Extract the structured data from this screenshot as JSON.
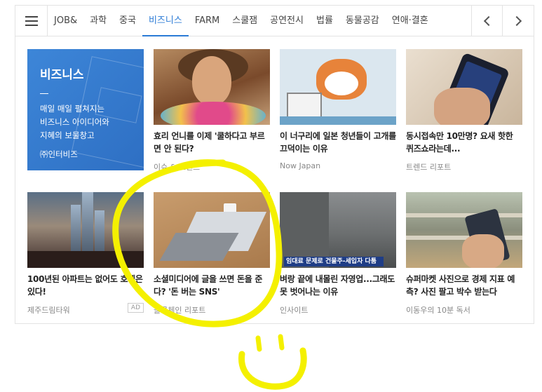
{
  "nav": {
    "menu_icon": "hamburger-icon",
    "tabs": [
      {
        "label": "JOB&",
        "active": false
      },
      {
        "label": "과학",
        "active": false
      },
      {
        "label": "중국",
        "active": false
      },
      {
        "label": "비즈니스",
        "active": true
      },
      {
        "label": "FARM",
        "active": false
      },
      {
        "label": "스쿨잼",
        "active": false
      },
      {
        "label": "공연전시",
        "active": false
      },
      {
        "label": "법률",
        "active": false
      },
      {
        "label": "동물공감",
        "active": false
      },
      {
        "label": "연애·결혼",
        "active": false
      }
    ],
    "prev_icon": "chevron-left-icon",
    "next_icon": "chevron-right-icon",
    "active_color": "#2b7bd6"
  },
  "promo": {
    "title": "비즈니스",
    "lines": [
      "매일 매일 펼쳐지는",
      "비즈니스 아이디어와",
      "지혜의 보물창고"
    ],
    "brand": "㈜인터비즈",
    "bg_color": "#3a80d2"
  },
  "cards": [
    {
      "title": "효리 언니를 이제 '쿨하다고 부르면 안 된다?",
      "source": "이슈 & 트렌드",
      "ad": ""
    },
    {
      "title": "이 너구리에 일본 청년들이 고개를 끄덕이는 이유",
      "source": "Now Japan",
      "ad": ""
    },
    {
      "title": "동시접속만 10만명? 요새 핫한 퀴즈쇼라는데...",
      "source": "트렌드 리포트",
      "ad": ""
    },
    {
      "title": "100년된 아파트는 없어도 호텔은 있다!",
      "source": "제주드림타워",
      "ad": "AD"
    },
    {
      "title": "소셜미디어에 글을 쓰면 돈을 준다? '돈 버는 SNS'",
      "source": "블록체인 리포트",
      "ad": ""
    },
    {
      "title": "벼랑 끝에 내몰린 자영업...그래도 못 벗어나는 이유",
      "source": "인사이트",
      "ad": "",
      "image_caption": "임대료 문제로 건물주-세입자 다툼"
    },
    {
      "title": "슈퍼마켓 사진으로 경제 지표 예측? 사진 팔고 박수 받는다",
      "source": "이동우의 10분 독서",
      "ad": ""
    }
  ],
  "annotation_color": "#f4f000"
}
